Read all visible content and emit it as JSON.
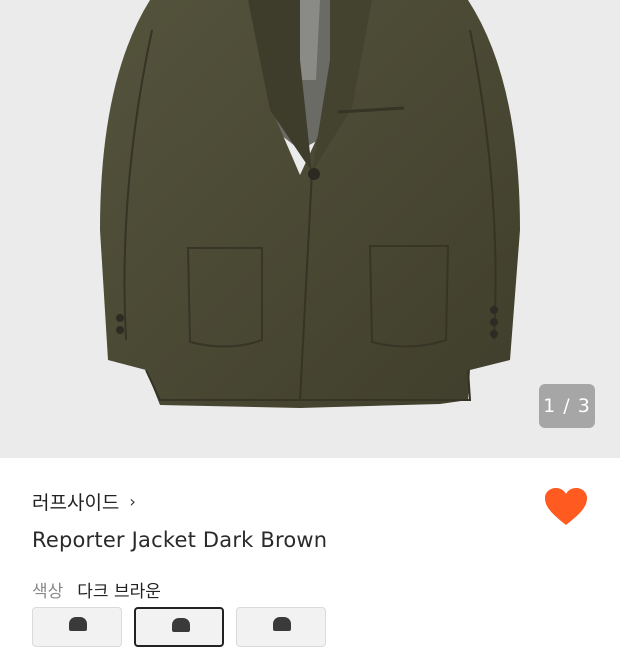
{
  "gallery": {
    "counter": "1 / 3"
  },
  "product": {
    "brand": "러프사이드",
    "brand_chevron": "›",
    "name": "Reporter Jacket Dark Brown",
    "liked": true
  },
  "options": {
    "color_label": "색상",
    "color_value": "다크 브라운",
    "swatches": [
      "swatch-1",
      "swatch-2-selected",
      "swatch-3"
    ]
  },
  "colors": {
    "like": "#ff5a1f",
    "jacket": "#4a4a36"
  }
}
